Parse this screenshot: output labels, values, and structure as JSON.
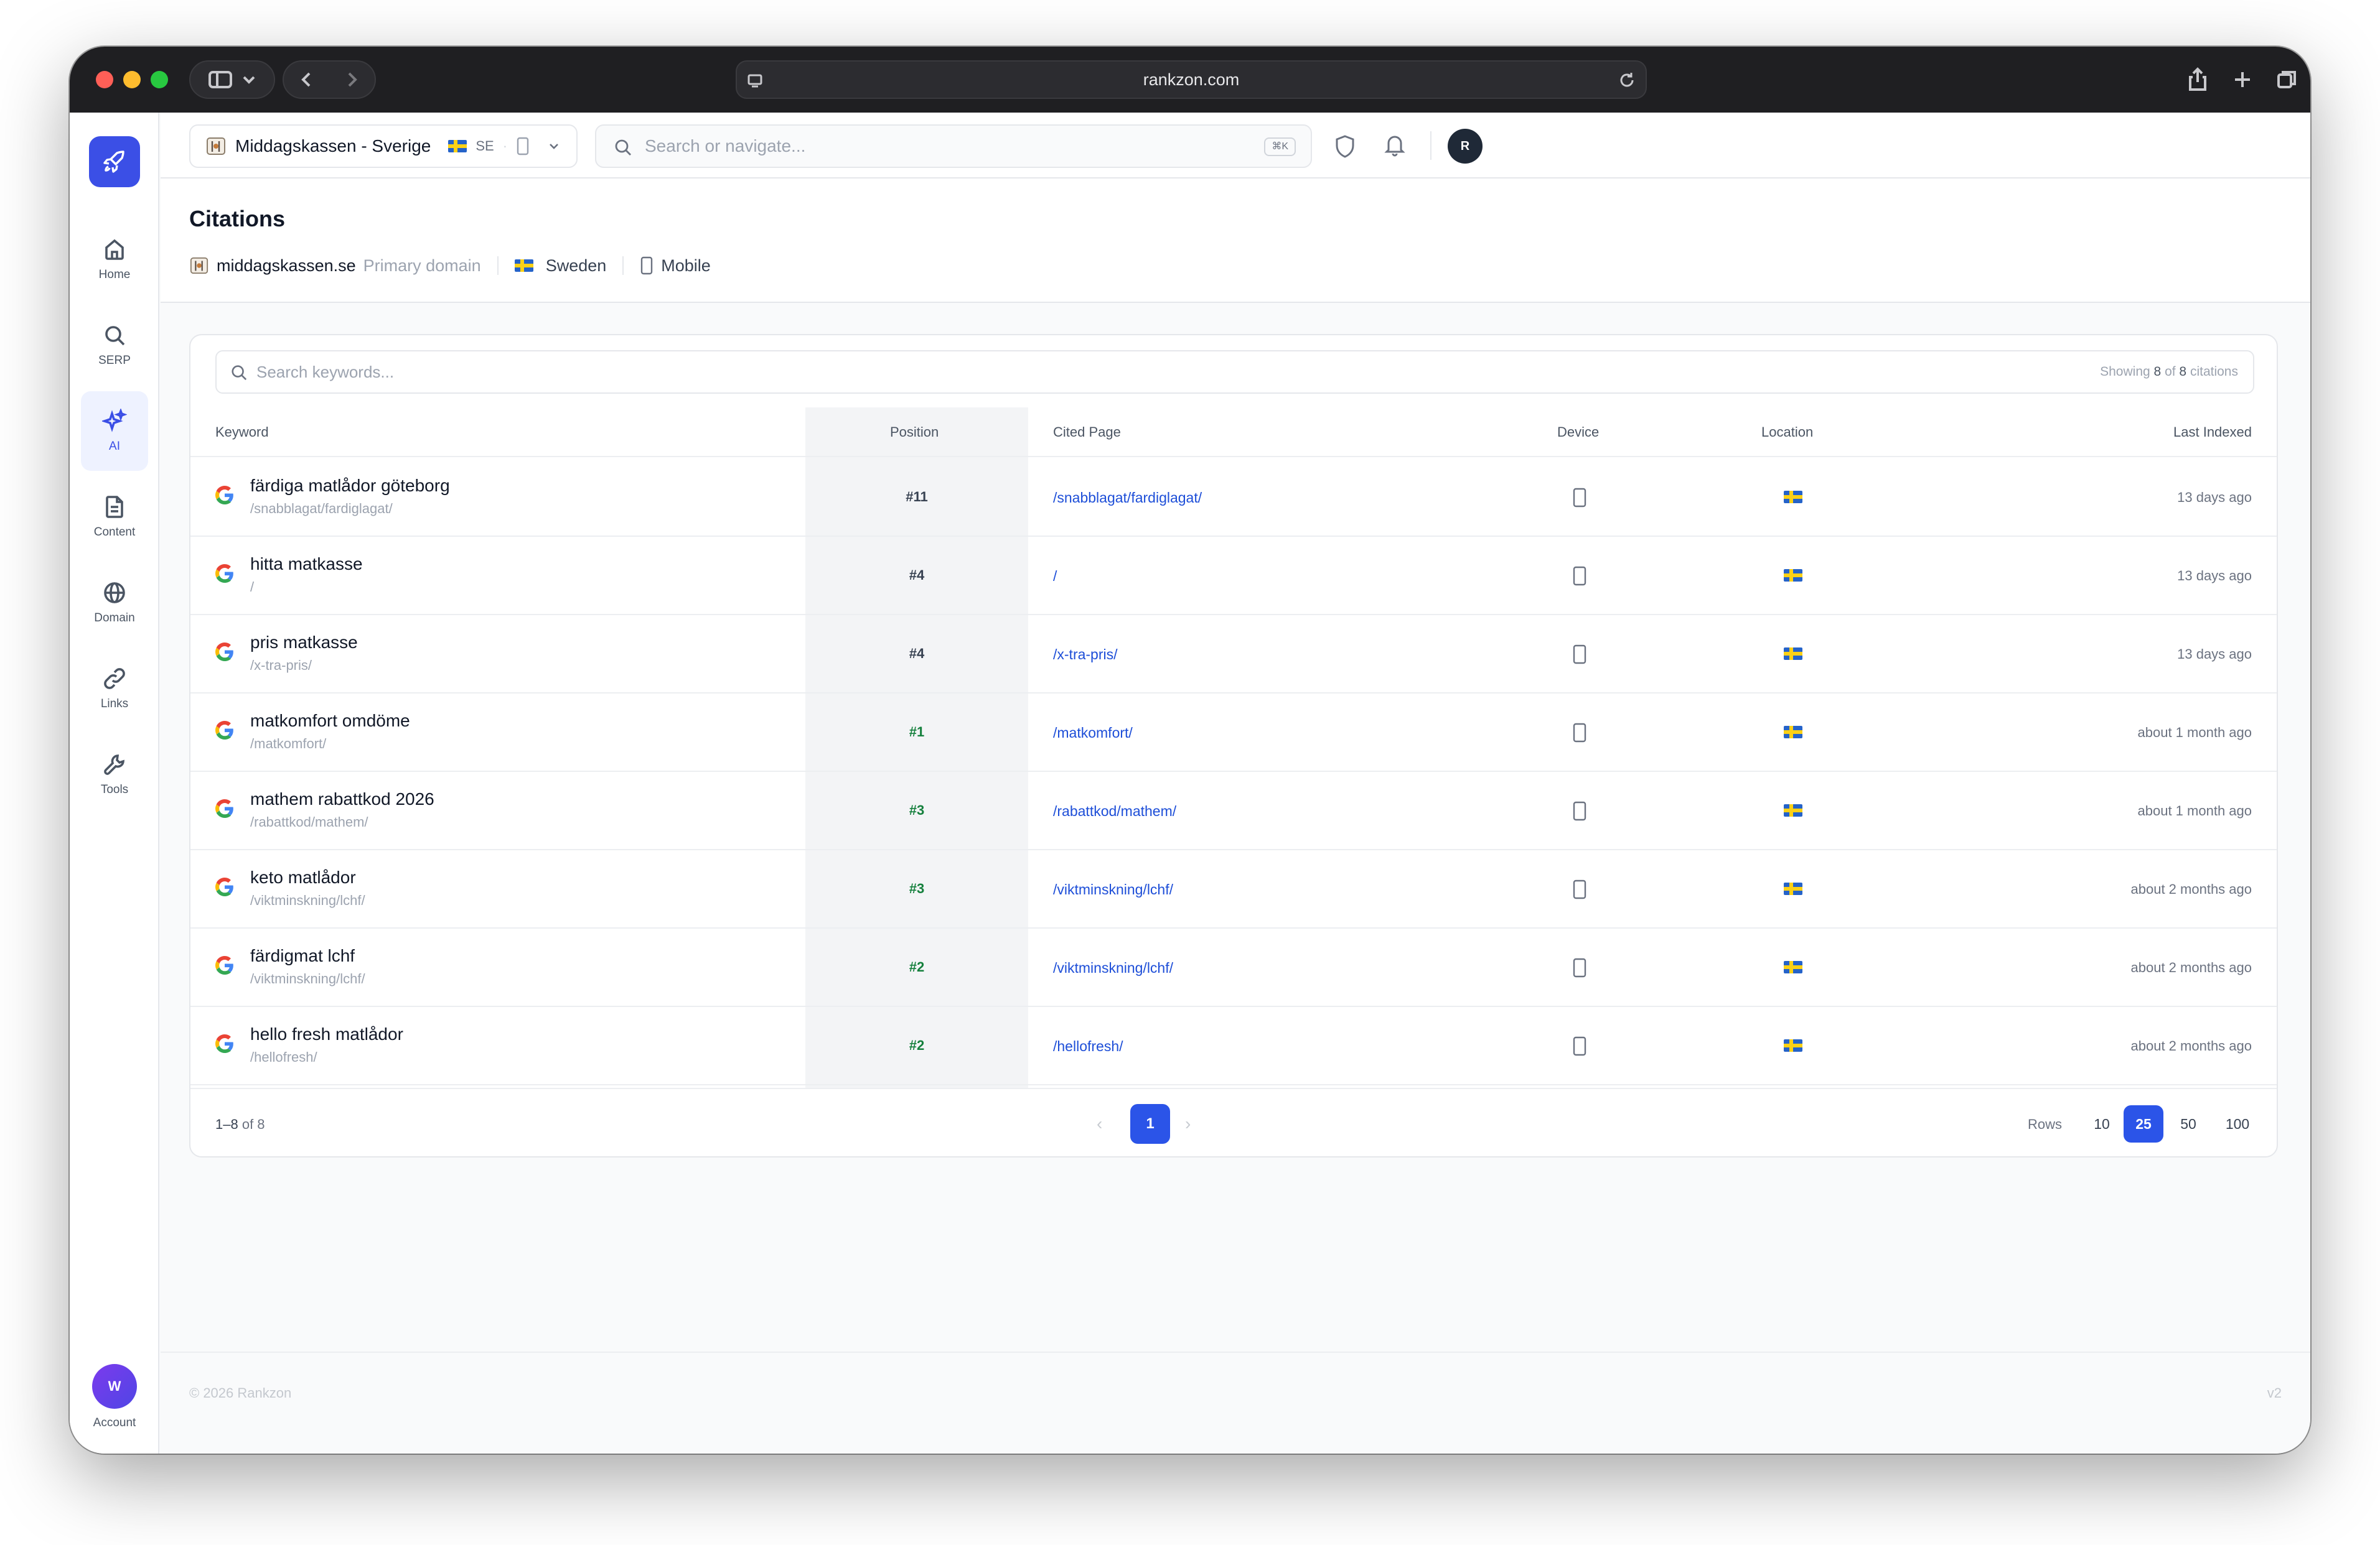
{
  "browser": {
    "url": "rankzon.com"
  },
  "sidebar": {
    "items": [
      {
        "label": "Home",
        "icon": "home-icon"
      },
      {
        "label": "SERP",
        "icon": "search-icon"
      },
      {
        "label": "AI",
        "icon": "sparkles-icon",
        "active": true
      },
      {
        "label": "Content",
        "icon": "document-icon"
      },
      {
        "label": "Domain",
        "icon": "globe-icon"
      },
      {
        "label": "Links",
        "icon": "link-icon"
      },
      {
        "label": "Tools",
        "icon": "wrench-icon"
      }
    ],
    "account": {
      "initial": "W",
      "label": "Account"
    }
  },
  "topbar": {
    "project": "Middagskassen - Sverige",
    "country_code": "SE",
    "search_placeholder": "Search or navigate...",
    "shortcut": "⌘K",
    "user_initial": "R"
  },
  "page": {
    "title": "Citations",
    "domain": "middagskassen.se",
    "domain_type": "Primary domain",
    "country": "Sweden",
    "device": "Mobile"
  },
  "table": {
    "search_placeholder": "Search keywords...",
    "showing": {
      "prefix": "Showing",
      "shown": "8",
      "of": "of",
      "total": "8",
      "suffix": "citations"
    },
    "columns": [
      "Keyword",
      "Position",
      "Cited Page",
      "Device",
      "Location",
      "Last Indexed"
    ],
    "rows": [
      {
        "keyword": "färdiga matlådor göteborg",
        "path": "/snabblagat/fardiglagat/",
        "position": "#11",
        "cited": "/snabblagat/fardiglagat/",
        "last": "13 days ago",
        "pos_color": "gray"
      },
      {
        "keyword": "hitta matkasse",
        "path": "/",
        "position": "#4",
        "cited": "/",
        "last": "13 days ago",
        "pos_color": "gray"
      },
      {
        "keyword": "pris matkasse",
        "path": "/x-tra-pris/",
        "position": "#4",
        "cited": "/x-tra-pris/",
        "last": "13 days ago",
        "pos_color": "gray"
      },
      {
        "keyword": "matkomfort omdöme",
        "path": "/matkomfort/",
        "position": "#1",
        "cited": "/matkomfort/",
        "last": "about 1 month ago",
        "pos_color": "green"
      },
      {
        "keyword": "mathem rabattkod 2026",
        "path": "/rabattkod/mathem/",
        "position": "#3",
        "cited": "/rabattkod/mathem/",
        "last": "about 1 month ago",
        "pos_color": "green"
      },
      {
        "keyword": "keto matlådor",
        "path": "/viktminskning/lchf/",
        "position": "#3",
        "cited": "/viktminskning/lchf/",
        "last": "about 2 months ago",
        "pos_color": "green"
      },
      {
        "keyword": "färdigmat lchf",
        "path": "/viktminskning/lchf/",
        "position": "#2",
        "cited": "/viktminskning/lchf/",
        "last": "about 2 months ago",
        "pos_color": "green"
      },
      {
        "keyword": "hello fresh matlådor",
        "path": "/hellofresh/",
        "position": "#2",
        "cited": "/hellofresh/",
        "last": "about 2 months ago",
        "pos_color": "green"
      }
    ],
    "footer": {
      "range": "1–8",
      "of": "of 8",
      "page": "1",
      "rows_label": "Rows",
      "row_options": [
        "10",
        "25",
        "50",
        "100"
      ],
      "selected_rows": "25"
    }
  },
  "footer": {
    "copyright": "© 2026 Rankzon",
    "version": "v2"
  },
  "colors": {
    "accent": "#2b54e8",
    "link": "#1d4ed8",
    "position_good": "#15803d"
  }
}
